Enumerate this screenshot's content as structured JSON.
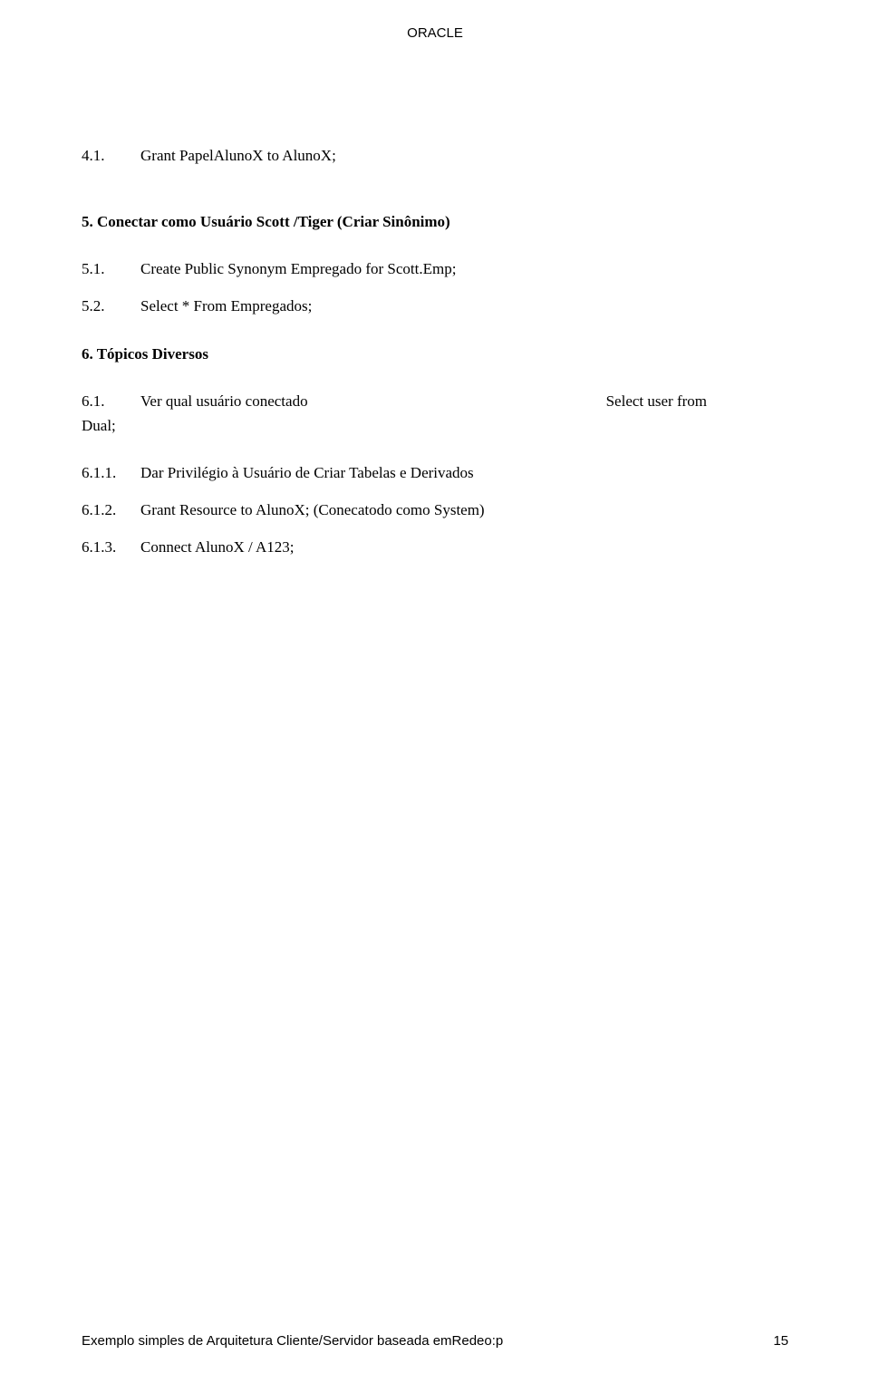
{
  "header": {
    "title": "ORACLE"
  },
  "items": {
    "i_4_1": {
      "num": "4.1.",
      "text": "Grant PapelAlunoX to AlunoX;"
    },
    "sec5": {
      "title": "5.  Conectar como Usuário Scott /Tiger (Criar Sinônimo)"
    },
    "i_5_1": {
      "num": "5.1.",
      "text": "Create Public Synonym Empregado for Scott.Emp;"
    },
    "i_5_2": {
      "num": "5.2.",
      "text": "Select * From  Empregados;"
    },
    "sec6": {
      "title": "6.  Tópicos Diversos"
    },
    "i_6_1": {
      "num": "6.1.",
      "text_left": "Ver qual usuário conectado",
      "text_right": "Select user from",
      "dual": "Dual;"
    },
    "i_6_1_1": {
      "num": "6.1.1.",
      "text": "Dar Privilégio à Usuário de Criar Tabelas e Derivados"
    },
    "i_6_1_2": {
      "num": "6.1.2.",
      "text": "Grant Resource to AlunoX; (Conecatodo como System)"
    },
    "i_6_1_3": {
      "num": "6.1.3.",
      "text": "Connect AlunoX / A123;"
    }
  },
  "footer": {
    "left": "Exemplo simples de Arquitetura Cliente/Servidor baseada emRedeo:p",
    "page": "15"
  }
}
